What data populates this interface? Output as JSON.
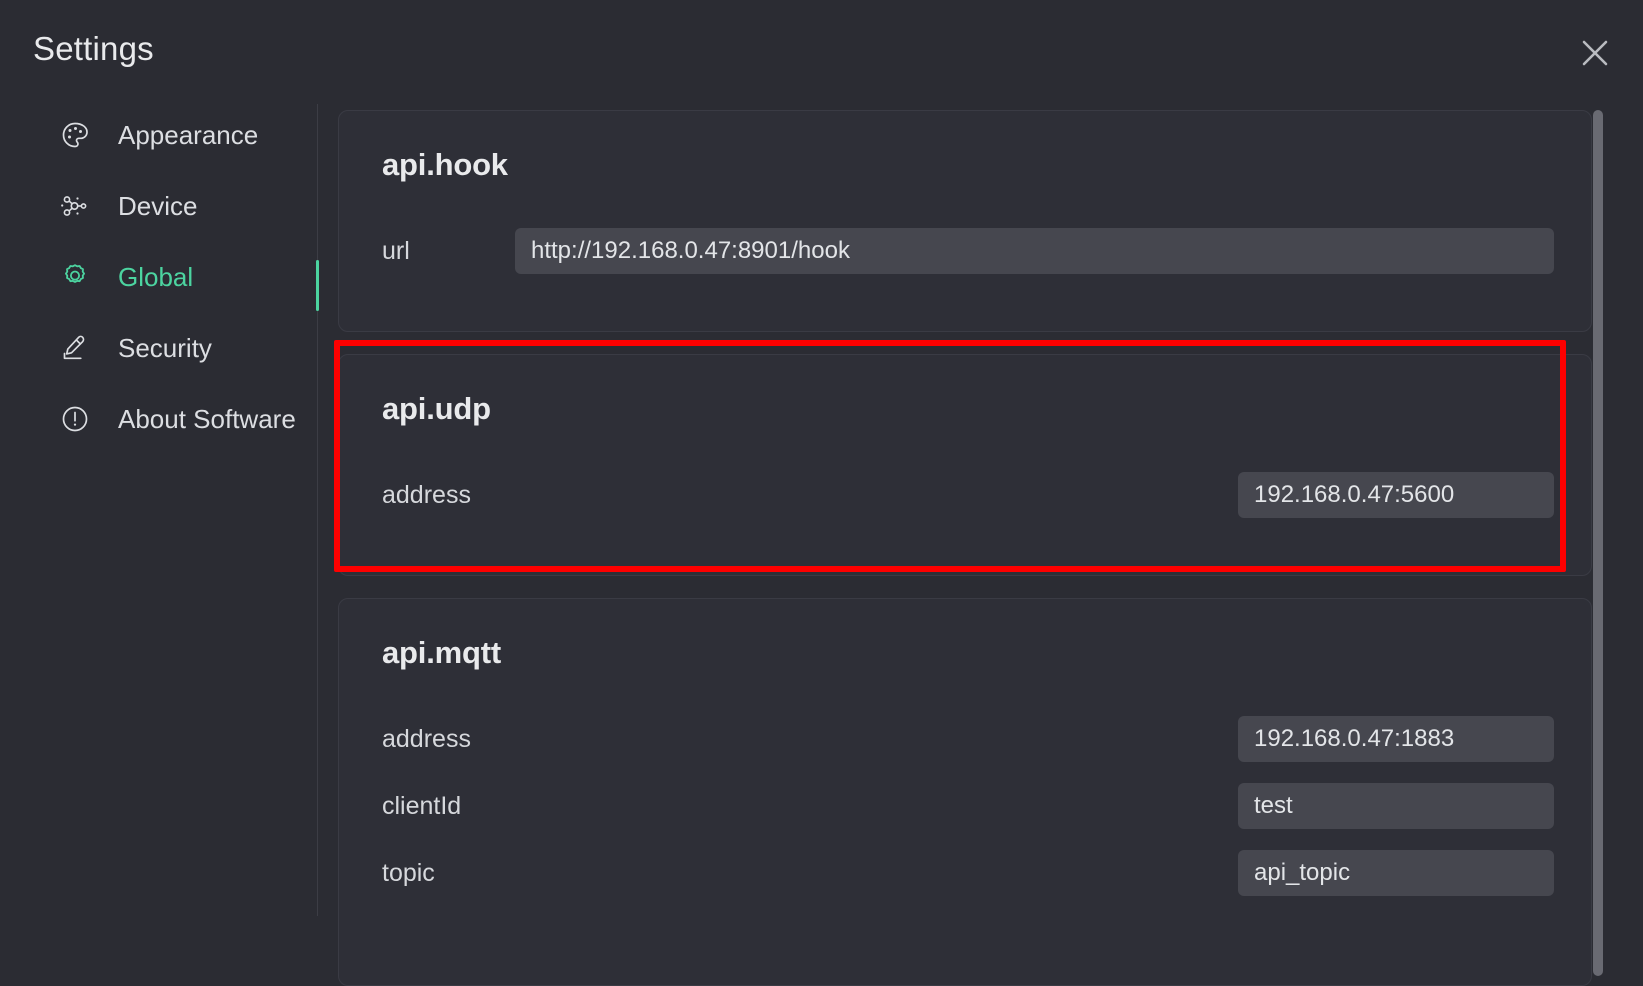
{
  "window": {
    "title": "Settings",
    "close_icon": "close-icon",
    "accent_color": "#4cd4a0",
    "highlight_color": "#fe0000",
    "background_color": "#2b2c33",
    "card_color": "#2e2f37",
    "input_color": "#46474f"
  },
  "sidebar": {
    "items": [
      {
        "label": "Appearance",
        "icon": "palette-icon",
        "active": false
      },
      {
        "label": "Device",
        "icon": "device-network-icon",
        "active": false
      },
      {
        "label": "Global",
        "icon": "gear-icon",
        "active": true
      },
      {
        "label": "Security",
        "icon": "security-pen-icon",
        "active": false
      },
      {
        "label": "About Software",
        "icon": "info-circle-icon",
        "active": false
      }
    ]
  },
  "content": {
    "sections": [
      {
        "title": "api.hook",
        "highlighted": false,
        "fields": [
          {
            "label": "url",
            "value": "http://192.168.0.47:8901/hook",
            "width": "wide"
          }
        ]
      },
      {
        "title": "api.udp",
        "highlighted": true,
        "fields": [
          {
            "label": "address",
            "value": "192.168.0.47:5600",
            "width": "narrow"
          }
        ]
      },
      {
        "title": "api.mqtt",
        "highlighted": false,
        "fields": [
          {
            "label": "address",
            "value": "192.168.0.47:1883",
            "width": "narrow"
          },
          {
            "label": "clientId",
            "value": "test",
            "width": "narrow"
          },
          {
            "label": "topic",
            "value": "api_topic",
            "width": "narrow"
          }
        ]
      }
    ]
  },
  "scrollbar": {
    "name": "vertical-scrollbar"
  }
}
